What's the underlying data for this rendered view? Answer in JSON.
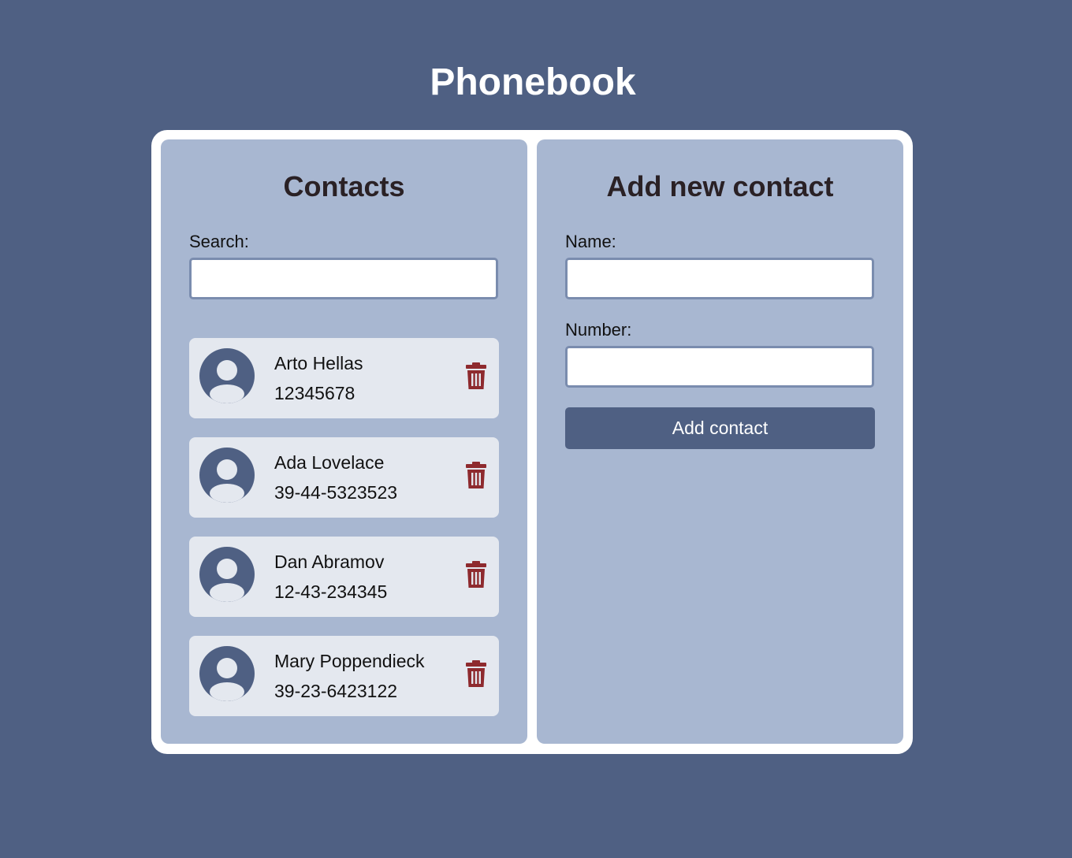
{
  "app": {
    "title": "Phonebook"
  },
  "contacts_panel": {
    "heading": "Contacts",
    "search_label": "Search:",
    "search_value": "",
    "contacts": [
      {
        "name": "Arto Hellas",
        "number": "12345678"
      },
      {
        "name": "Ada Lovelace",
        "number": "39-44-5323523"
      },
      {
        "name": "Dan Abramov",
        "number": "12-43-234345"
      },
      {
        "name": "Mary Poppendieck",
        "number": "39-23-6423122"
      }
    ]
  },
  "add_panel": {
    "heading": "Add new contact",
    "name_label": "Name:",
    "name_value": "",
    "number_label": "Number:",
    "number_value": "",
    "submit_label": "Add contact"
  },
  "colors": {
    "background": "#4f6083",
    "panel": "#a8b7d1",
    "card": "#e4e8ef",
    "avatar": "#4f6083",
    "delete": "#8e2a2e",
    "button": "#4f6083"
  },
  "icons": {
    "avatar": "user-avatar-icon",
    "delete": "trash-icon"
  }
}
